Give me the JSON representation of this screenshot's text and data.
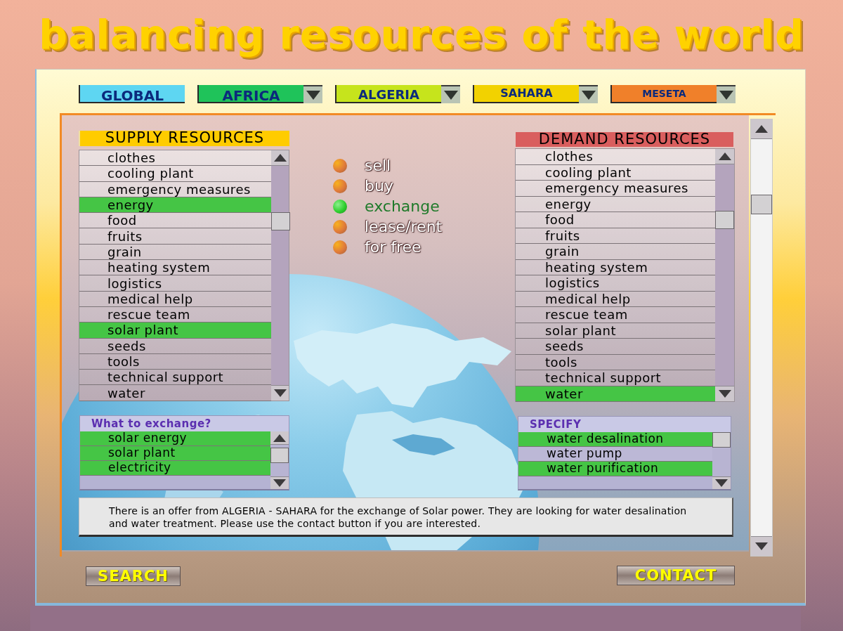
{
  "title": "balancing resources of the world",
  "nav": [
    {
      "label": "GLOBAL",
      "color": "#5ed6f2",
      "kind": "button"
    },
    {
      "label": "AFRICA",
      "color": "#1fc35a",
      "kind": "dropdown"
    },
    {
      "label": "ALGERIA",
      "color": "#c6e41c",
      "kind": "dropdown"
    },
    {
      "label": "SAHARA",
      "color": "#f2d200",
      "kind": "dropdown"
    },
    {
      "label": "MESETA",
      "color": "#f0802a",
      "kind": "dropdown"
    }
  ],
  "supply": {
    "title": "SUPPLY RESOURCES",
    "items": [
      {
        "label": "clothes",
        "selected": false
      },
      {
        "label": "cooling plant",
        "selected": false
      },
      {
        "label": "emergency measures",
        "selected": false
      },
      {
        "label": "energy",
        "selected": true
      },
      {
        "label": "food",
        "selected": false
      },
      {
        "label": "fruits",
        "selected": false
      },
      {
        "label": "grain",
        "selected": false
      },
      {
        "label": "heating system",
        "selected": false
      },
      {
        "label": "logistics",
        "selected": false
      },
      {
        "label": "medical help",
        "selected": false
      },
      {
        "label": "rescue team",
        "selected": false
      },
      {
        "label": "solar plant",
        "selected": true
      },
      {
        "label": "seeds",
        "selected": false
      },
      {
        "label": "tools",
        "selected": false
      },
      {
        "label": "technical support",
        "selected": false
      },
      {
        "label": "water",
        "selected": false
      }
    ]
  },
  "modes": [
    {
      "label": "sell",
      "selected": false
    },
    {
      "label": "buy",
      "selected": false
    },
    {
      "label": "exchange",
      "selected": true
    },
    {
      "label": "lease/rent",
      "selected": false
    },
    {
      "label": "for free",
      "selected": false
    }
  ],
  "demand": {
    "title": "DEMAND RESOURCES",
    "items": [
      {
        "label": "clothes",
        "selected": false
      },
      {
        "label": "cooling plant",
        "selected": false
      },
      {
        "label": "emergency measures",
        "selected": false
      },
      {
        "label": "energy",
        "selected": false
      },
      {
        "label": "food",
        "selected": false
      },
      {
        "label": "fruits",
        "selected": false
      },
      {
        "label": "grain",
        "selected": false
      },
      {
        "label": "heating system",
        "selected": false
      },
      {
        "label": "logistics",
        "selected": false
      },
      {
        "label": "medical help",
        "selected": false
      },
      {
        "label": "rescue team",
        "selected": false
      },
      {
        "label": "solar plant",
        "selected": false
      },
      {
        "label": "seeds",
        "selected": false
      },
      {
        "label": "tools",
        "selected": false
      },
      {
        "label": "technical support",
        "selected": false
      },
      {
        "label": "water",
        "selected": true
      }
    ]
  },
  "exchange": {
    "title": "What to exchange?",
    "items": [
      {
        "label": "solar energy",
        "selected": true
      },
      {
        "label": "solar plant",
        "selected": true
      },
      {
        "label": "electricity",
        "selected": true
      }
    ]
  },
  "specify": {
    "title": "SPECIFY",
    "items": [
      {
        "label": "water desalination",
        "selected": true
      },
      {
        "label": "water pump",
        "selected": false
      },
      {
        "label": "water purification",
        "selected": true
      }
    ]
  },
  "message": "There is an offer from ALGERIA - SAHARA for the exchange of Solar power. They are looking for water desalination and water treatment. Please use the contact button if you are interested.",
  "buttons": [
    "SEARCH",
    "CONTACT"
  ]
}
